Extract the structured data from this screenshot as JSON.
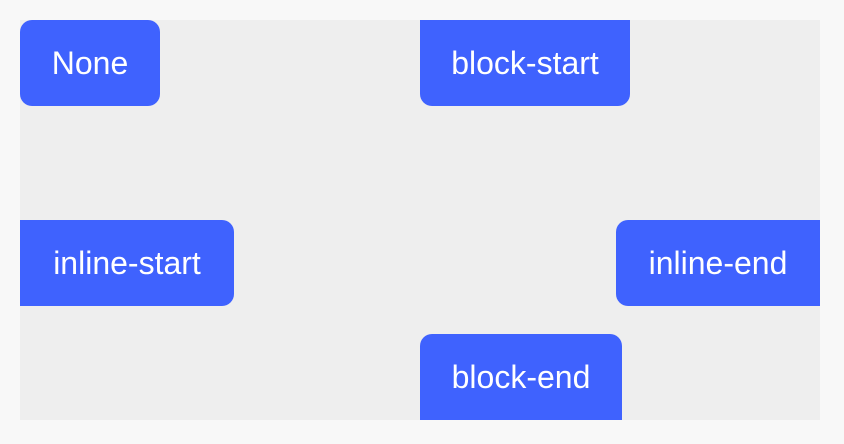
{
  "buttons": {
    "none": "None",
    "block_start": "block-start",
    "inline_start": "inline-start",
    "inline_end": "inline-end",
    "block_end": "block-end"
  },
  "colors": {
    "page_background": "#f8f8f8",
    "stage_background": "#eeeeee",
    "button_background": "#3f62fe",
    "button_text": "#ffffff"
  }
}
